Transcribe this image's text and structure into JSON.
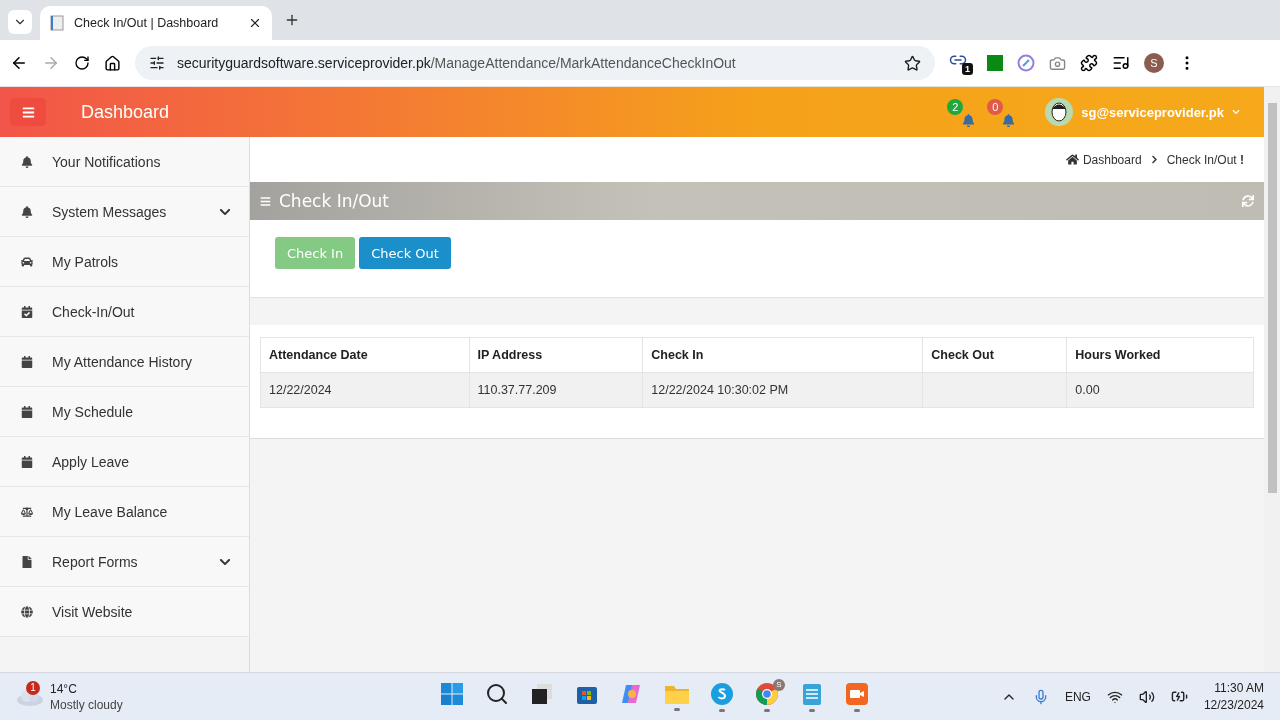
{
  "browser": {
    "tab_title": "Check In/Out | Dashboard",
    "address_host": "securityguardsoftware.serviceprovider.pk",
    "address_path": "/ManageAttendance/MarkAttendanceCheckInOut",
    "extension_badge": "1",
    "profile_initial": "S"
  },
  "header": {
    "title": "Dashboard",
    "notifications": [
      {
        "count": "2",
        "color": "#1fa83c"
      },
      {
        "count": "0",
        "color": "#e05a47"
      }
    ],
    "user": "sg@serviceprovider.pk"
  },
  "sidebar": {
    "items": [
      {
        "label": "Your Notifications"
      },
      {
        "label": "System Messages",
        "expanded": false
      },
      {
        "label": "My Patrols"
      },
      {
        "label": "Check-In/Out"
      },
      {
        "label": "My Attendance History"
      },
      {
        "label": "My Schedule"
      },
      {
        "label": "Apply Leave"
      },
      {
        "label": "My Leave Balance"
      },
      {
        "label": "Report Forms",
        "expanded": false
      },
      {
        "label": "Visit Website"
      }
    ]
  },
  "breadcrumb": {
    "items": [
      "Dashboard",
      "Check In/Out **!**"
    ]
  },
  "panel": {
    "title": "Check In/Out",
    "buttons": [
      {
        "label": "Check In",
        "kind": "success",
        "disabled": true
      },
      {
        "label": "Check Out",
        "kind": "primary",
        "disabled": false
      }
    ]
  },
  "table": {
    "columns": [
      "Attendance Date",
      "IP Address",
      "Check In",
      "Check Out",
      "Hours Worked"
    ],
    "rows": [
      [
        "12/22/2024",
        "110.37.77.209",
        "12/22/2024 10:30:02 PM",
        "",
        "0.00"
      ]
    ]
  },
  "taskbar": {
    "weather": {
      "badge": "1",
      "temperature": "14°C",
      "condition": "Mostly cloudy"
    },
    "apps": [
      {
        "kind": "start",
        "running": false
      },
      {
        "kind": "search",
        "running": false
      },
      {
        "kind": "taskview",
        "running": false
      },
      {
        "kind": "store",
        "running": false
      },
      {
        "kind": "copilot",
        "running": false
      },
      {
        "kind": "explorer",
        "running": true
      },
      {
        "kind": "skype",
        "running": true
      },
      {
        "kind": "chrome",
        "running": true,
        "badge": "S"
      },
      {
        "kind": "notepad",
        "running": true
      },
      {
        "kind": "recorder",
        "running": true
      }
    ],
    "language": "ENG",
    "time": "11:30 AM",
    "date": "12/23/2024"
  }
}
